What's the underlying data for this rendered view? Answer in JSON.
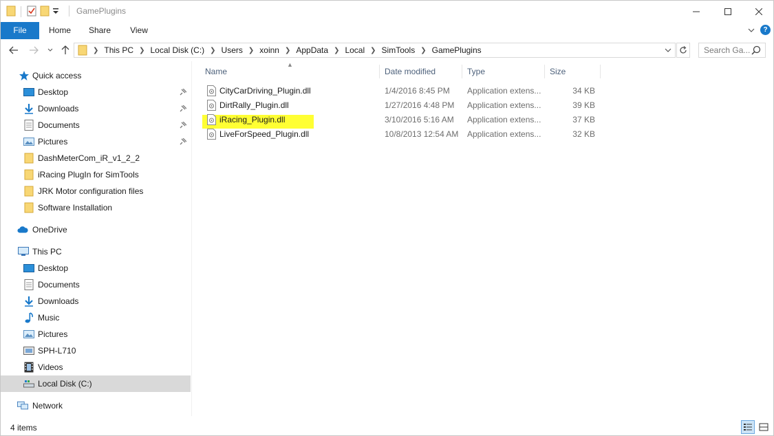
{
  "window": {
    "title": "GamePlugins"
  },
  "ribbon": {
    "file_label": "File",
    "home_label": "Home",
    "share_label": "Share",
    "view_label": "View"
  },
  "address": {
    "crumbs": [
      "This PC",
      "Local Disk (C:)",
      "Users",
      "xoinn",
      "AppData",
      "Local",
      "SimTools",
      "GamePlugins"
    ],
    "search_placeholder": "Search Ga..."
  },
  "nav": {
    "quick_access": "Quick access",
    "quick_items": [
      {
        "label": "Desktop",
        "pinned": true
      },
      {
        "label": "Downloads",
        "pinned": true
      },
      {
        "label": "Documents",
        "pinned": true
      },
      {
        "label": "Pictures",
        "pinned": true
      },
      {
        "label": "DashMeterCom_iR_v1_2_2",
        "pinned": false
      },
      {
        "label": "iRacing PlugIn for SimTools",
        "pinned": false
      },
      {
        "label": "JRK Motor configuration files",
        "pinned": false
      },
      {
        "label": "Software Installation",
        "pinned": false
      }
    ],
    "onedrive": "OneDrive",
    "this_pc": "This PC",
    "pc_items": [
      "Desktop",
      "Documents",
      "Downloads",
      "Music",
      "Pictures",
      "SPH-L710",
      "Videos",
      "Local Disk (C:)"
    ],
    "network": "Network"
  },
  "columns": {
    "name": "Name",
    "date": "Date modified",
    "type": "Type",
    "size": "Size"
  },
  "files": [
    {
      "name": "CityCarDriving_Plugin.dll",
      "date": "1/4/2016 8:45 PM",
      "type": "Application extens...",
      "size": "34 KB"
    },
    {
      "name": "DirtRally_Plugin.dll",
      "date": "1/27/2016 4:48 PM",
      "type": "Application extens...",
      "size": "39 KB"
    },
    {
      "name": "iRacing_Plugin.dll",
      "date": "3/10/2016 5:16 AM",
      "type": "Application extens...",
      "size": "37 KB"
    },
    {
      "name": "LiveForSpeed_Plugin.dll",
      "date": "10/8/2013 12:54 AM",
      "type": "Application extens...",
      "size": "32 KB"
    }
  ],
  "status": {
    "items": "4 items"
  },
  "colors": {
    "accent": "#1979ca",
    "highlight": "#ffff33",
    "folder": "#f8d775",
    "selected_nav": "#d9d9d9"
  }
}
